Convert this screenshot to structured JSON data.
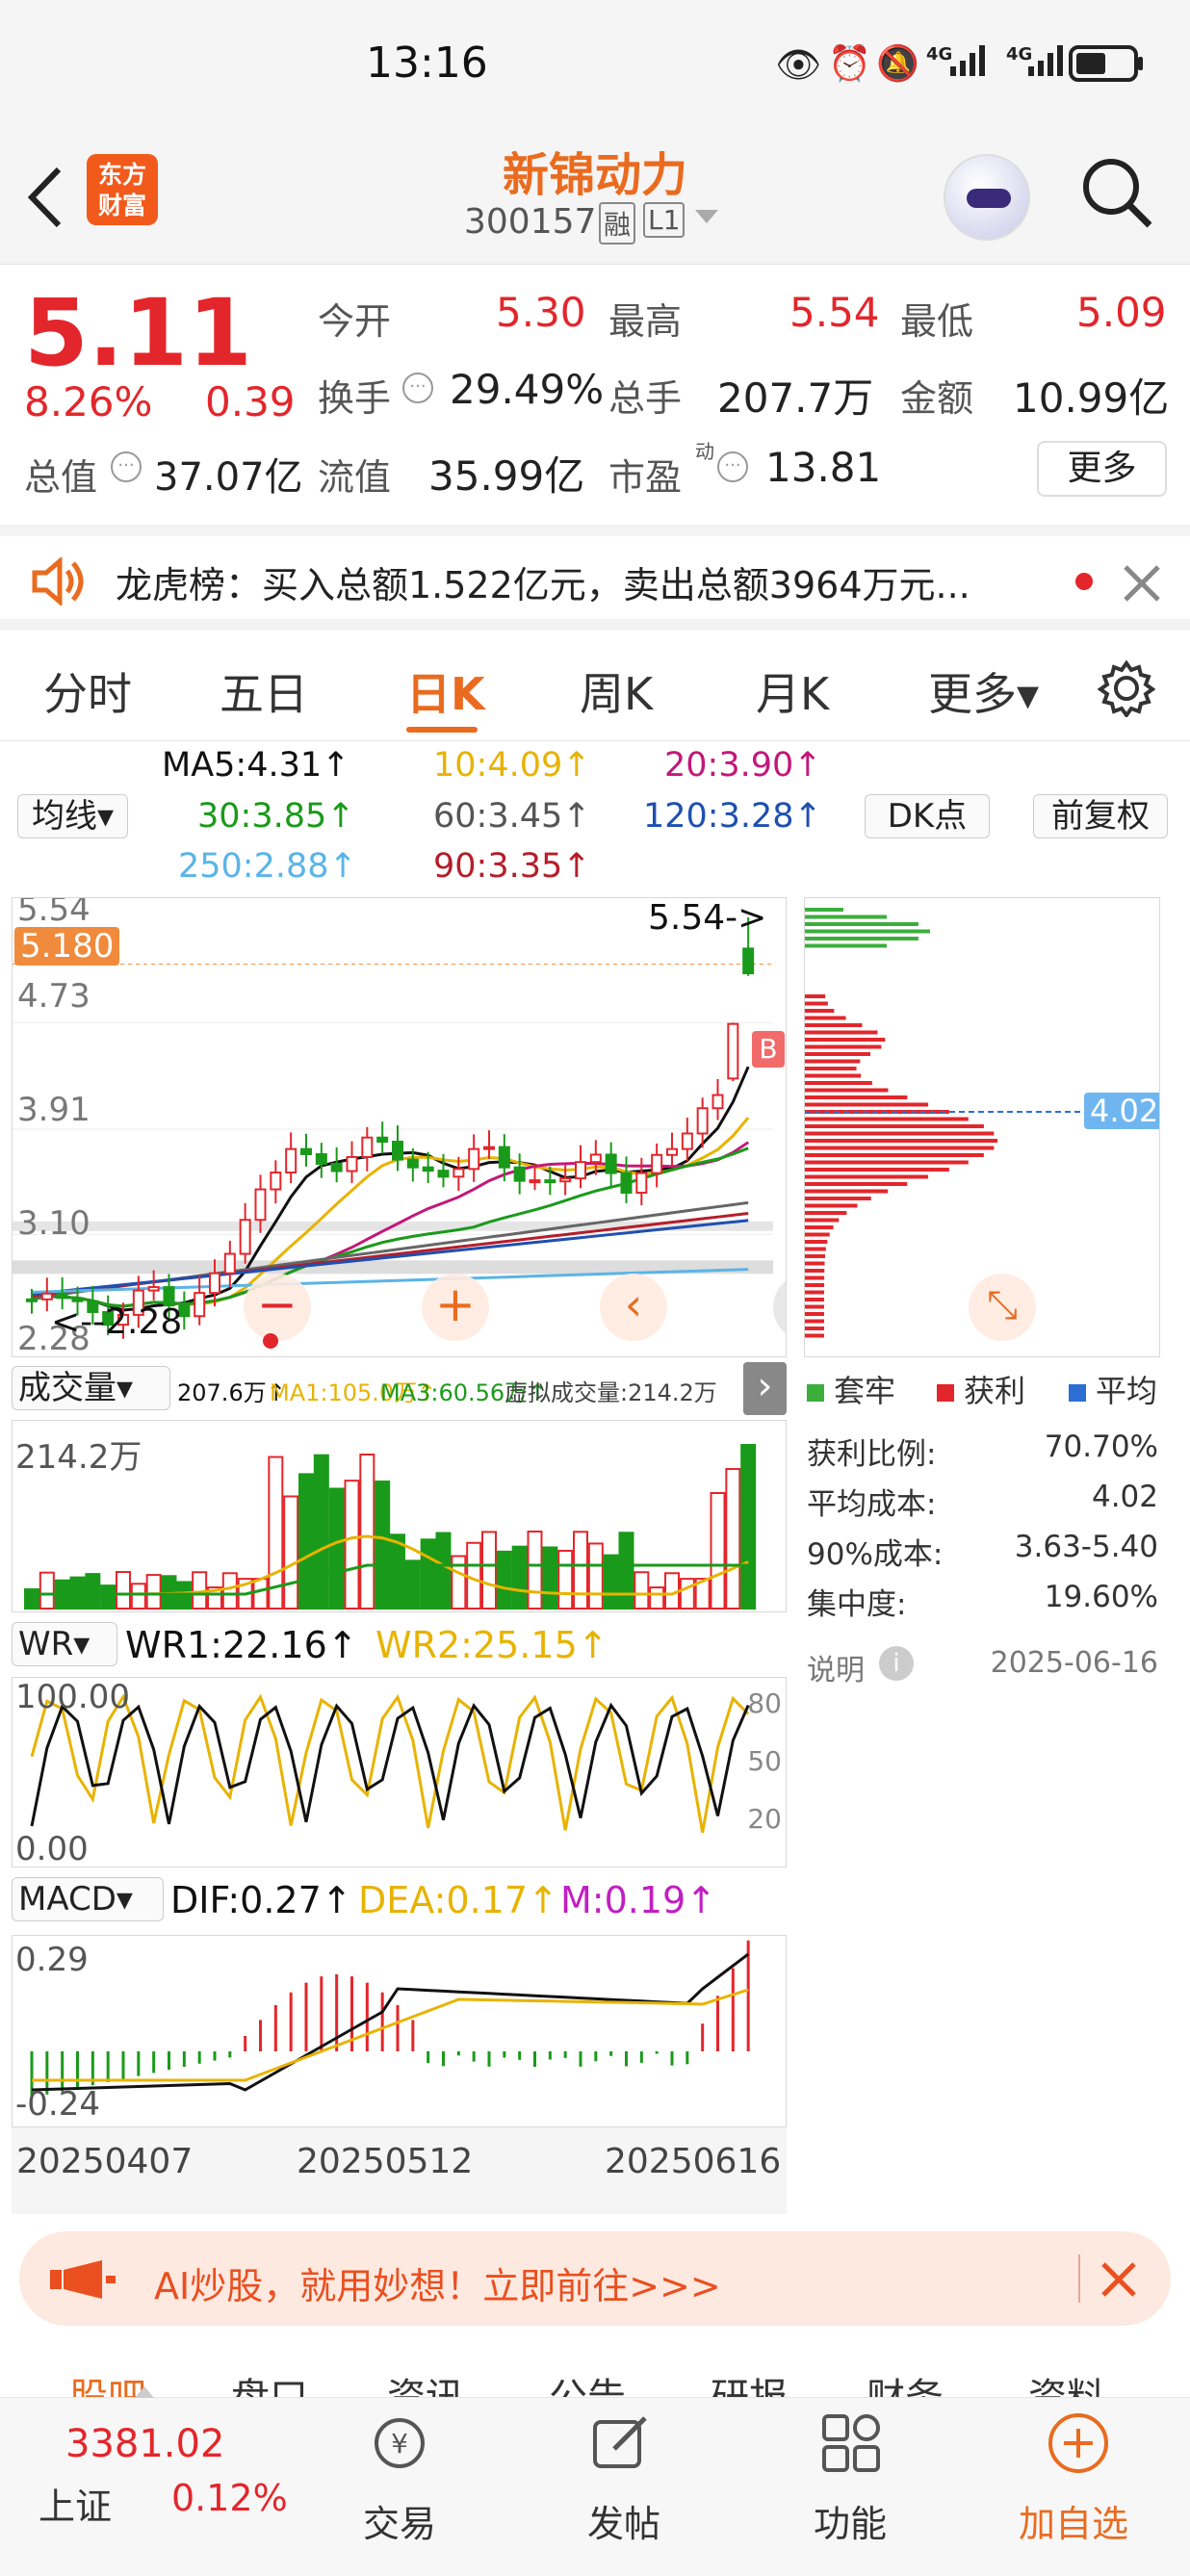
{
  "status_bar": {
    "time": "13:16",
    "signal1": "4G",
    "signal2": "4G"
  },
  "header": {
    "stock_name": "新锦动力",
    "code": "300157",
    "tag_rong": "融",
    "tag_level": "L1",
    "logo_line1": "东方",
    "logo_line2": "财富"
  },
  "quote": {
    "price": "5.11",
    "pct": "8.26%",
    "change": "0.39",
    "open_label": "今开",
    "open": "5.30",
    "high_label": "最高",
    "high": "5.54",
    "low_label": "最低",
    "low": "5.09",
    "turnover_label": "换手",
    "turnover": "29.49%",
    "vol_label": "总手",
    "vol": "207.7万",
    "amount_label": "金额",
    "amount": "10.99亿",
    "mcap_label": "总值",
    "mcap": "37.07亿",
    "float_label": "流值",
    "float_cap": "35.99亿",
    "pe_label": "市盈",
    "pe_sup": "动",
    "pe": "13.81",
    "more": "更多"
  },
  "notice": {
    "text": "龙虎榜：买入总额1.522亿元，卖出总额3964万元..."
  },
  "tabs": [
    "分时",
    "五日",
    "日K",
    "周K",
    "月K",
    "更多▾"
  ],
  "ma_legend": {
    "selector": "均线▾",
    "ma5": "MA5:4.31↑",
    "ma10": "10:4.09↑",
    "ma20": "20:3.90↑",
    "ma30": "30:3.85↑",
    "ma60": "60:3.45↑",
    "ma120": "120:3.28↑",
    "ma250": "250:2.88↑",
    "ma90": "90:3.35↑",
    "dk": "DK点",
    "fq": "前复权"
  },
  "kline": {
    "top": "5.54",
    "price_tag": "5.180",
    "l1": "4.73",
    "l2": "3.91",
    "l3": "3.10",
    "bottom": "2.28",
    "max_note": "5.54->",
    "min_note": "<--2.28",
    "b_mark": "B"
  },
  "volume": {
    "selector": "成交量▾",
    "v": "207.6万↑",
    "ma1": "MA1:105.0万↑",
    "ma3": "MA3:60.56万↑",
    "virtual": "虚拟成交量:214.2万",
    "top": "214.2万"
  },
  "wr": {
    "selector": "WR▾",
    "wr1": "WR1:22.16↑",
    "wr2": "WR2:25.15↑",
    "top": "100.00",
    "bottom": "0.00",
    "r80": "80",
    "r50": "50",
    "r20": "20"
  },
  "macd": {
    "selector": "MACD▾",
    "dif": "DIF:0.27↑",
    "dea": "DEA:0.17↑",
    "m": "M:0.19↑",
    "top": "0.29",
    "bottom": "-0.24"
  },
  "dates": [
    "20250407",
    "20250512",
    "20250616"
  ],
  "chip": {
    "cost_tag": "4.02",
    "legend": [
      "套牢",
      "获利",
      "平均"
    ],
    "rows": [
      {
        "k": "获利比例:",
        "v": "70.70%"
      },
      {
        "k": "平均成本:",
        "v": "4.02"
      },
      {
        "k": "90%成本:",
        "v": "3.63-5.40"
      },
      {
        "k": "集中度:",
        "v": "19.60%"
      }
    ],
    "note": "说明",
    "date": "2025-06-16"
  },
  "ai_banner": "AI炒股，就用妙想！立即前往>>>",
  "bottom_nav": {
    "tabs": [
      "股吧",
      "盘口",
      "资讯",
      "公告",
      "研报",
      "财务",
      "资料"
    ],
    "index_value": "3381.02",
    "index_name": "上证",
    "index_pct": "0.12%",
    "items": [
      "交易",
      "发帖",
      "功能",
      "加自选"
    ]
  },
  "chart_data": {
    "type": "candlestick",
    "title": "",
    "xlabel": "",
    "ylabel": "",
    "x": [
      "20250407",
      "20250512",
      "20250616"
    ],
    "price_axis": [
      2.28,
      3.1,
      3.91,
      4.73,
      5.54
    ],
    "last_close": 5.11,
    "high": 5.54,
    "low": 2.28,
    "ma": {
      "MA5": 4.31,
      "MA10": 4.09,
      "MA20": 3.9,
      "MA30": 3.85,
      "MA60": 3.45,
      "MA90": 3.35,
      "MA120": 3.28,
      "MA250": 2.88
    },
    "colors": {
      "up": "#e3262b",
      "down": "#1a9a1a",
      "ma5": "#111111",
      "ma10": "#e8b300",
      "ma20": "#c2187a",
      "ma30": "#1a9a1a",
      "ma60": "#666666",
      "ma90": "#b51e2a",
      "ma120": "#1f4fb0",
      "ma250": "#5ab4e8"
    }
  }
}
